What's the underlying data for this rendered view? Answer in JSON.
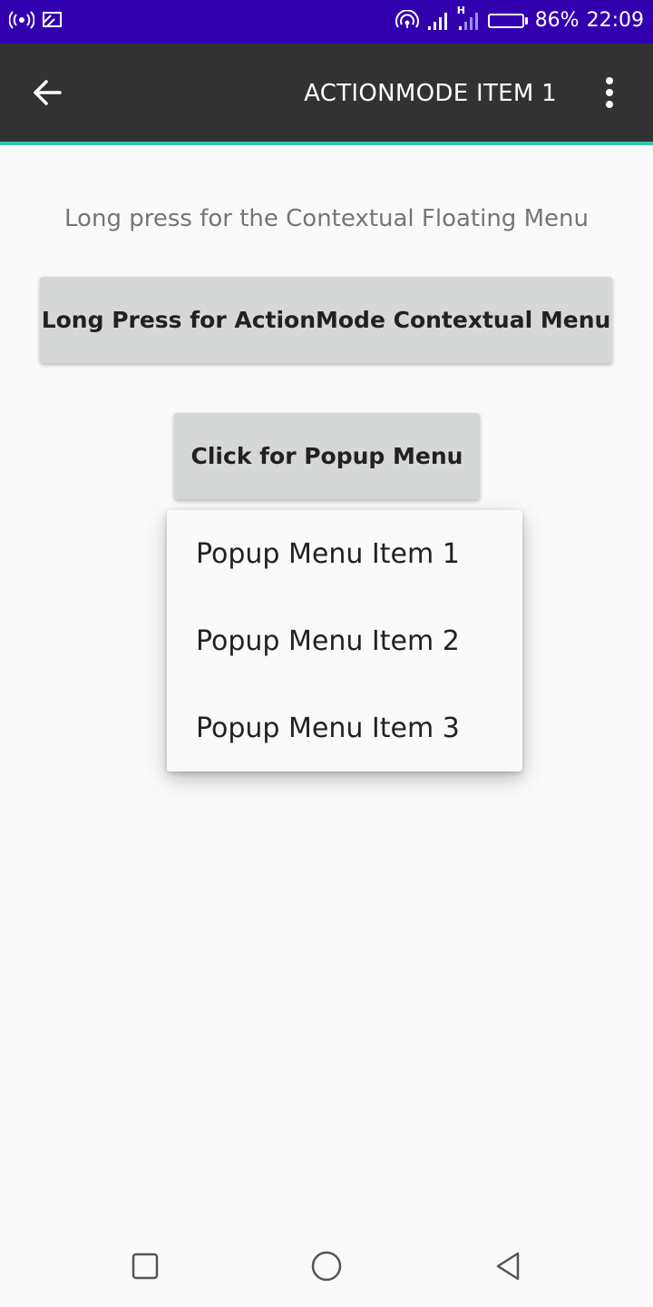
{
  "status_bar": {
    "battery_percent": "86%",
    "battery_level": 0.86,
    "time": "22:09",
    "network_type": "H",
    "icons": [
      "hotspot-icon",
      "cast-icon",
      "wifi-icon",
      "signal-icon",
      "signal-icon",
      "battery-icon"
    ]
  },
  "action_bar": {
    "title": "ACTIONMODE ITEM 1",
    "icons": [
      "back-arrow-icon",
      "overflow-menu-icon"
    ]
  },
  "main": {
    "hint": "Long press for the Contextual Floating Menu",
    "actionmode_button_label": "Long Press for ActionMode Contextual Menu",
    "popup_button_label": "Click for Popup Menu"
  },
  "popup_menu": {
    "items": [
      {
        "label": "Popup Menu Item 1"
      },
      {
        "label": "Popup Menu Item 2"
      },
      {
        "label": "Popup Menu Item 3"
      }
    ]
  },
  "nav_bar": {
    "icons": [
      "recents-icon",
      "home-icon",
      "back-icon"
    ]
  },
  "colors": {
    "status_bar": "#3300b0",
    "action_bar": "#323232",
    "accent": "#34c3b0",
    "button": "#d6d7d7",
    "background": "#fafafa"
  }
}
